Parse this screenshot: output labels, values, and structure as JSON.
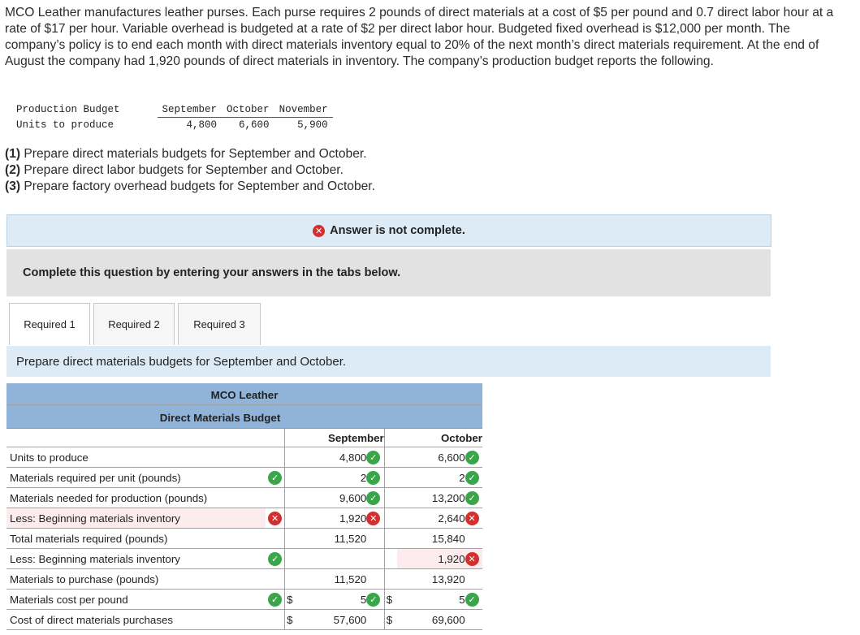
{
  "intro": "MCO Leather manufactures leather purses. Each purse requires 2 pounds of direct materials at a cost of $5 per pound and 0.7 direct labor hour at a rate of $17 per hour. Variable overhead is budgeted at a rate of $2 per direct labor hour. Budgeted fixed overhead is $12,000 per month. The company’s policy is to end each month with direct materials inventory equal to 20% of the next month’s direct materials requirement. At the end of August the company had 1,920 pounds of direct materials in inventory. The company’s production budget reports the following.",
  "production_budget": {
    "title": "Production Budget",
    "row_label": "Units to produce",
    "months": [
      "September",
      "October",
      "November"
    ],
    "values": [
      "4,800",
      "6,600",
      "5,900"
    ]
  },
  "requirements": [
    {
      "num": "(1)",
      "text": "Prepare direct materials budgets for September and October."
    },
    {
      "num": "(2)",
      "text": "Prepare direct labor budgets for September and October."
    },
    {
      "num": "(3)",
      "text": "Prepare factory overhead budgets for September and October."
    }
  ],
  "notice": "Answer is not complete.",
  "complete_prompt": "Complete this question by entering your answers in the tabs below.",
  "tabs": [
    "Required 1",
    "Required 2",
    "Required 3"
  ],
  "instruction": "Prepare direct materials budgets for September and October.",
  "budget": {
    "company": "MCO Leather",
    "title": "Direct Materials Budget",
    "col_sep": "September",
    "col_oct": "October",
    "rows": [
      {
        "label": "Units to produce",
        "ind": "",
        "sep": "4,800",
        "sep_mark": "check",
        "oct": "6,600",
        "oct_mark": "check",
        "cur": ""
      },
      {
        "label": "Materials required per unit (pounds)",
        "ind": "check",
        "sep": "2",
        "sep_mark": "check",
        "oct": "2",
        "oct_mark": "check",
        "cur": ""
      },
      {
        "label": "Materials needed for production (pounds)",
        "ind": "",
        "sep": "9,600",
        "sep_mark": "check",
        "oct": "13,200",
        "oct_mark": "check",
        "cur": ""
      },
      {
        "label": "Less: Beginning materials inventory",
        "ind": "x",
        "sep": "1,920",
        "sep_mark": "x",
        "oct": "2,640",
        "oct_mark": "x",
        "cur": ""
      },
      {
        "label": "Total materials required (pounds)",
        "ind": "",
        "sep": "11,520",
        "sep_mark": "",
        "oct": "15,840",
        "oct_mark": "",
        "cur": ""
      },
      {
        "label": "Less: Beginning materials inventory",
        "ind": "check",
        "sep": "",
        "sep_mark": "",
        "oct": "1,920",
        "oct_mark": "x",
        "cur": ""
      },
      {
        "label": "Materials to purchase (pounds)",
        "ind": "",
        "sep": "11,520",
        "sep_mark": "",
        "oct": "13,920",
        "oct_mark": "",
        "cur": ""
      },
      {
        "label": "Materials cost per pound",
        "ind": "check",
        "sep": "5",
        "sep_mark": "check",
        "oct": "5",
        "oct_mark": "check",
        "cur": "$"
      },
      {
        "label": "Cost of direct materials purchases",
        "ind": "",
        "sep": "57,600",
        "sep_mark": "",
        "oct": "69,600",
        "oct_mark": "",
        "cur": "$"
      }
    ]
  },
  "colors": {
    "check": "#3aa64a",
    "x": "#d32f2f",
    "header_blue": "#8fb3d9",
    "notice_bg": "#dcebf6"
  }
}
